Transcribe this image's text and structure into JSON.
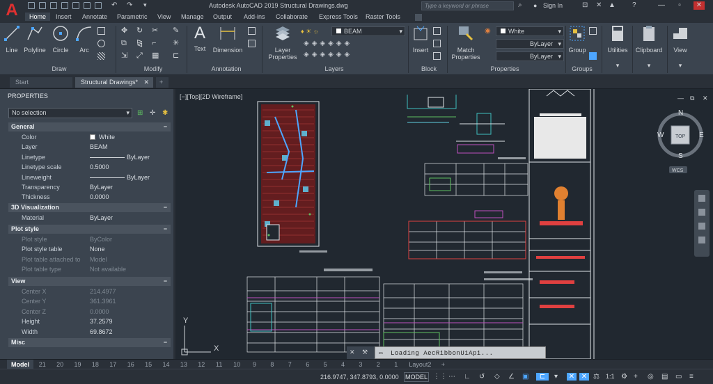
{
  "app": {
    "title": "Autodesk AutoCAD 2019    Structural Drawings.dwg",
    "search_placeholder": "Type a keyword or phrase",
    "sign_in": "Sign In",
    "accent": "#e03030"
  },
  "ribbon_tabs": [
    "Home",
    "Insert",
    "Annotate",
    "Parametric",
    "View",
    "Manage",
    "Output",
    "Add-ins",
    "Collaborate",
    "Express Tools",
    "Raster Tools"
  ],
  "ribbon": {
    "draw": {
      "label": "Draw",
      "line": "Line",
      "polyline": "Polyline",
      "circle": "Circle",
      "arc": "Arc"
    },
    "modify": {
      "label": "Modify"
    },
    "annotation": {
      "label": "Annotation",
      "text": "Text",
      "dimension": "Dimension"
    },
    "layers": {
      "label": "Layers",
      "layer_properties_1": "Layer",
      "layer_properties_2": "Properties",
      "current_layer": "BEAM"
    },
    "block": {
      "label": "Block",
      "insert": "Insert"
    },
    "properties": {
      "label": "Properties",
      "match_1": "Match",
      "match_2": "Properties",
      "color": "White",
      "linetype": "ByLayer",
      "lineweight": "ByLayer"
    },
    "groups": {
      "label": "Groups",
      "group": "Group"
    },
    "utilities": "Utilities",
    "clipboard": "Clipboard",
    "view": "View"
  },
  "doc_tabs": [
    "Start",
    "Structural Drawings*"
  ],
  "properties_panel": {
    "title": "PROPERTIES",
    "selection": "No selection",
    "sections": {
      "general": "General",
      "viz3d": "3D Visualization",
      "plot_style": "Plot style",
      "view": "View",
      "misc": "Misc"
    },
    "general": [
      {
        "k": "Color",
        "v": "White"
      },
      {
        "k": "Layer",
        "v": "BEAM"
      },
      {
        "k": "Linetype",
        "v": "ByLayer"
      },
      {
        "k": "Linetype scale",
        "v": "0.5000"
      },
      {
        "k": "Lineweight",
        "v": "ByLayer"
      },
      {
        "k": "Transparency",
        "v": "ByLayer"
      },
      {
        "k": "Thickness",
        "v": "0.0000"
      }
    ],
    "viz3d": [
      {
        "k": "Material",
        "v": "ByLayer"
      }
    ],
    "plot_style": [
      {
        "k": "Plot style",
        "v": "ByColor"
      },
      {
        "k": "Plot style table",
        "v": "None"
      },
      {
        "k": "Plot table attached to",
        "v": "Model"
      },
      {
        "k": "Plot table type",
        "v": "Not available"
      }
    ],
    "view": [
      {
        "k": "Center X",
        "v": "214.4977"
      },
      {
        "k": "Center Y",
        "v": "361.3961"
      },
      {
        "k": "Center Z",
        "v": "0.0000"
      },
      {
        "k": "Height",
        "v": "37.2579"
      },
      {
        "k": "Width",
        "v": "69.8672"
      }
    ]
  },
  "viewport": {
    "label": "[−][Top][2D Wireframe]",
    "viewcube": {
      "n": "N",
      "s": "S",
      "w": "W",
      "e": "E",
      "top": "TOP",
      "wcs": "WCS"
    },
    "ucs": {
      "x": "X",
      "y": "Y"
    }
  },
  "command_line": "Loading AecRibbonUiApi...",
  "layout_tabs": [
    "Model",
    "21",
    "20",
    "19",
    "18",
    "17",
    "16",
    "15",
    "14",
    "13",
    "12",
    "11",
    "10",
    "9",
    "8",
    "7",
    "6",
    "5",
    "4",
    "3",
    "2",
    "1",
    "Layout2"
  ],
  "status": {
    "coords": "216.9747, 347.8793, 0.0000",
    "model": "MODEL",
    "scale": "1:1"
  }
}
